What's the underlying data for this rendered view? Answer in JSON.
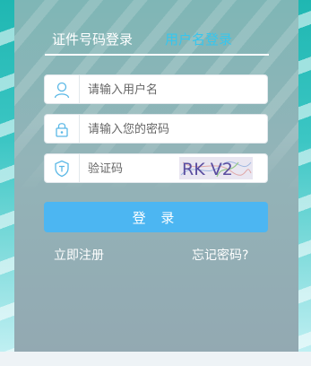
{
  "tabs": {
    "id_login": "证件号码登录",
    "username_login": "用户名登录"
  },
  "fields": {
    "username_placeholder": "请输入用户名",
    "password_placeholder": "请输入您的密码",
    "code_placeholder": "验证码"
  },
  "captcha": {
    "text": "RK V2"
  },
  "buttons": {
    "login": "登 录"
  },
  "links": {
    "register": "立即注册",
    "forgot_password": "忘记密码?"
  },
  "colors": {
    "accent_blue": "#4cb6f2",
    "active_tab_color": "#36c6ee",
    "icon_color": "#5ab8e6"
  },
  "icons": {
    "username": "user-icon",
    "password": "lock-icon",
    "captcha": "shield-icon"
  }
}
